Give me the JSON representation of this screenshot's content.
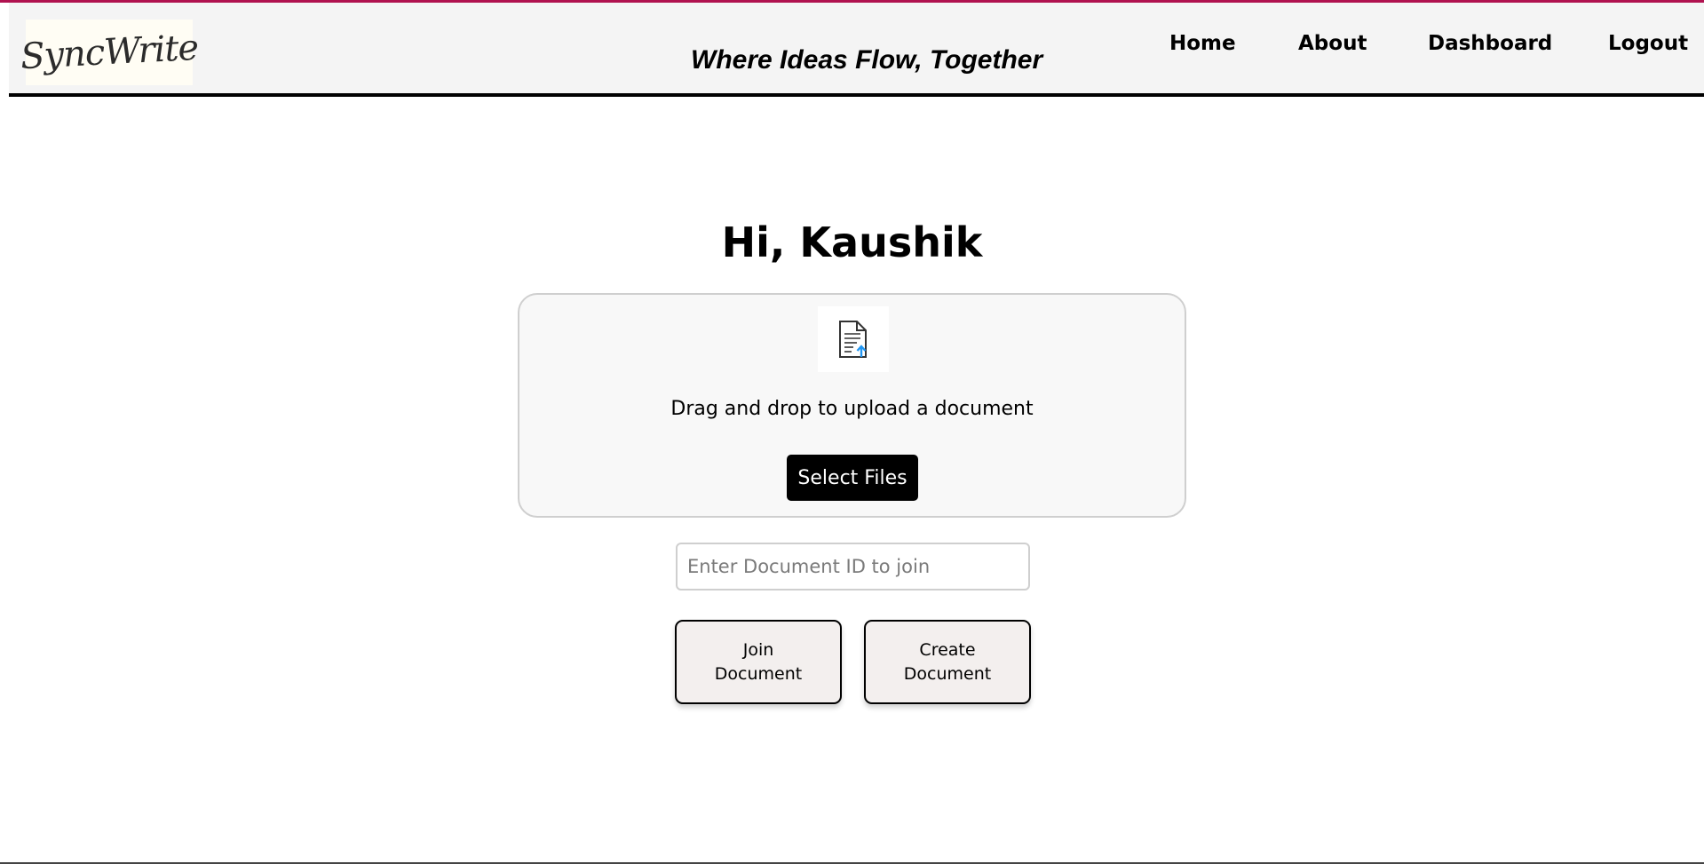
{
  "colors": {
    "accent": "#b0124f",
    "navbar_bg": "#f4f4f4",
    "button_dark": "#000000",
    "upload_icon_arrow": "#2196f3"
  },
  "header": {
    "logo_text": "SyncWrite",
    "tagline": "Where Ideas Flow, Together",
    "nav": {
      "home": "Home",
      "about": "About",
      "dashboard": "Dashboard",
      "logout": "Logout"
    }
  },
  "main": {
    "greeting": "Hi, Kaushik",
    "upload": {
      "icon": "document-upload-icon",
      "text": "Drag and drop to upload a document",
      "button_label": "Select Files"
    },
    "join": {
      "placeholder": "Enter Document ID to join",
      "value": ""
    },
    "buttons": {
      "join_label": "Join Document",
      "create_label": "Create Document"
    }
  }
}
